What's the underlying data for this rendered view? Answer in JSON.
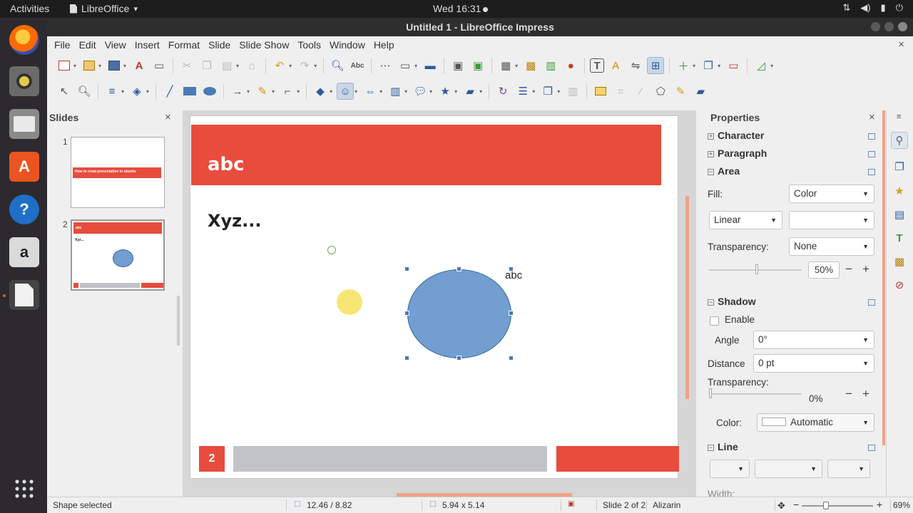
{
  "topbar": {
    "activities": "Activities",
    "app_name": "LibreOffice",
    "app_menu_caret": "▾",
    "clock": "Wed 16:31",
    "tray_icons": [
      "network-icon",
      "volume-icon",
      "battery-icon",
      "power-icon"
    ]
  },
  "launcher": {
    "items": [
      "firefox-icon",
      "rhythmbox-icon",
      "files-icon",
      "software-center-icon",
      "help-icon",
      "amazon-icon",
      "libreoffice-impress-icon"
    ],
    "apps_grid_icon": "show-applications-icon"
  },
  "window": {
    "title": "Untitled 1 - LibreOffice Impress"
  },
  "menubar": {
    "items": [
      "File",
      "Edit",
      "View",
      "Insert",
      "Format",
      "Slide",
      "Slide Show",
      "Tools",
      "Window",
      "Help"
    ],
    "close_doc": "×"
  },
  "slides_pane": {
    "title": "Slides",
    "close": "×",
    "thumbs": [
      {
        "num": "1",
        "banner_text": "How to creat presentation in ubuntu"
      },
      {
        "num": "2",
        "banner_text": "abc",
        "body_text": "Xyz..."
      }
    ]
  },
  "slide": {
    "title": "abc",
    "subtitle": "Xyz...",
    "shape_text": "abc",
    "slide_number": "2",
    "colors": {
      "accent": "#e74c3c",
      "shape_fill": "#729fcf",
      "footer_grey": "#c1c3c8"
    }
  },
  "sidebar": {
    "title": "Properties",
    "close": "×",
    "sections": {
      "character": "Character",
      "paragraph": "Paragraph",
      "area": "Area",
      "shadow": "Shadow",
      "line": "Line"
    },
    "area": {
      "fill_label": "Fill:",
      "fill_value": "Color",
      "gradient_type": "Linear",
      "gradient_value": "",
      "transparency_label": "Transparency:",
      "transparency_value": "None",
      "transparency_percent": "50%"
    },
    "shadow": {
      "enable_label": "Enable",
      "enabled": false,
      "angle_label": "Angle",
      "angle_value": "0°",
      "distance_label": "Distance",
      "distance_value": "0 pt",
      "transparency_label": "Transparency:",
      "transparency_percent": "0%",
      "color_label": "Color:",
      "color_value": "Automatic"
    },
    "line": {
      "width_label": "Width:"
    }
  },
  "statusbar": {
    "status": "Shape selected",
    "position": "12.46 / 8.82",
    "size": "5.94 x 5.14",
    "slide_info": "Slide 2 of 2",
    "master": "Alizarin",
    "zoom": "69%",
    "zoom_minus": "−",
    "zoom_plus": "+"
  }
}
